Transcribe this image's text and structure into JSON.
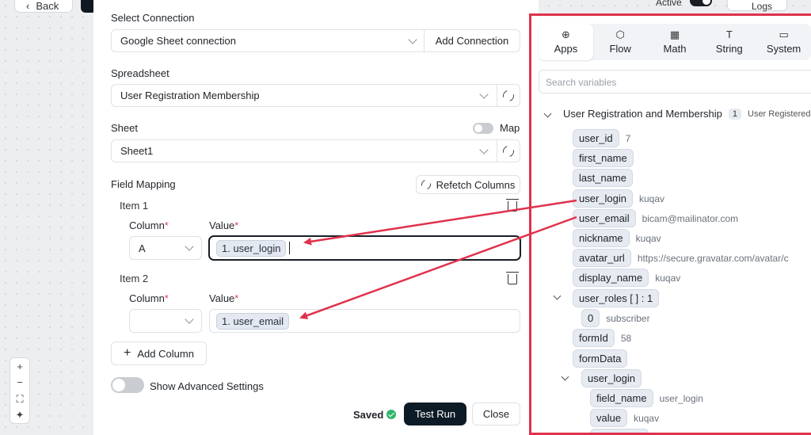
{
  "canvas": {
    "back_label": "Back",
    "active_label": "Active",
    "logs_label": "Logs",
    "zoom": [
      "+",
      "−",
      "⛶",
      "✦"
    ]
  },
  "modal": {
    "select_connection_label": "Select Connection",
    "connection_value": "Google Sheet connection",
    "add_connection": "Add Connection",
    "spreadsheet_label": "Spreadsheet",
    "spreadsheet_value": "User Registration Membership",
    "sheet_label": "Sheet",
    "map_label": "Map",
    "sheet_value": "Sheet1",
    "field_mapping_label": "Field Mapping",
    "refetch_columns": "Refetch Columns",
    "items": [
      {
        "title": "Item 1",
        "column_label": "Column",
        "value_label": "Value",
        "column_value": "A",
        "value_chip": "1. user_login"
      },
      {
        "title": "Item 2",
        "column_label": "Column",
        "value_label": "Value",
        "column_value": "",
        "value_chip": "1. user_email"
      }
    ],
    "required_mark": "*",
    "add_column": "Add Column",
    "show_advanced": "Show Advanced Settings",
    "saved_label": "Saved",
    "test_run": "Test Run",
    "close": "Close"
  },
  "panel": {
    "tabs": [
      {
        "label": "Apps",
        "icon": "globe-icon"
      },
      {
        "label": "Flow",
        "icon": "cube-icon"
      },
      {
        "label": "Math",
        "icon": "calculator-icon"
      },
      {
        "label": "String",
        "icon": "text-icon"
      },
      {
        "label": "System",
        "icon": "monitor-icon"
      }
    ],
    "search_placeholder": "Search variables",
    "group_title": "User Registration and Membership",
    "group_count": "1",
    "group_subtitle": "User Registered",
    "vars": [
      {
        "key": "user_id",
        "value": "7"
      },
      {
        "key": "first_name",
        "value": ""
      },
      {
        "key": "last_name",
        "value": ""
      },
      {
        "key": "user_login",
        "value": "kuqav"
      },
      {
        "key": "user_email",
        "value": "bicam@mailinator.com"
      },
      {
        "key": "nickname",
        "value": "kuqav"
      },
      {
        "key": "avatar_url",
        "value": "https://secure.gravatar.com/avatar/c"
      },
      {
        "key": "display_name",
        "value": "kuqav"
      },
      {
        "key": "user_roles [ ] : 1",
        "value": ""
      },
      {
        "key": "0",
        "value": "subscriber"
      },
      {
        "key": "formId",
        "value": "58"
      },
      {
        "key": "formData",
        "value": ""
      },
      {
        "key": "user_login",
        "value": ""
      },
      {
        "key": "field_name",
        "value": "user_login"
      },
      {
        "key": "value",
        "value": "kuqav"
      }
    ]
  },
  "colors": {
    "highlight_border": "#e0314b",
    "arrow": "#e0314b",
    "primary_button": "#0d1b26",
    "saved_check": "#2fb56a"
  }
}
